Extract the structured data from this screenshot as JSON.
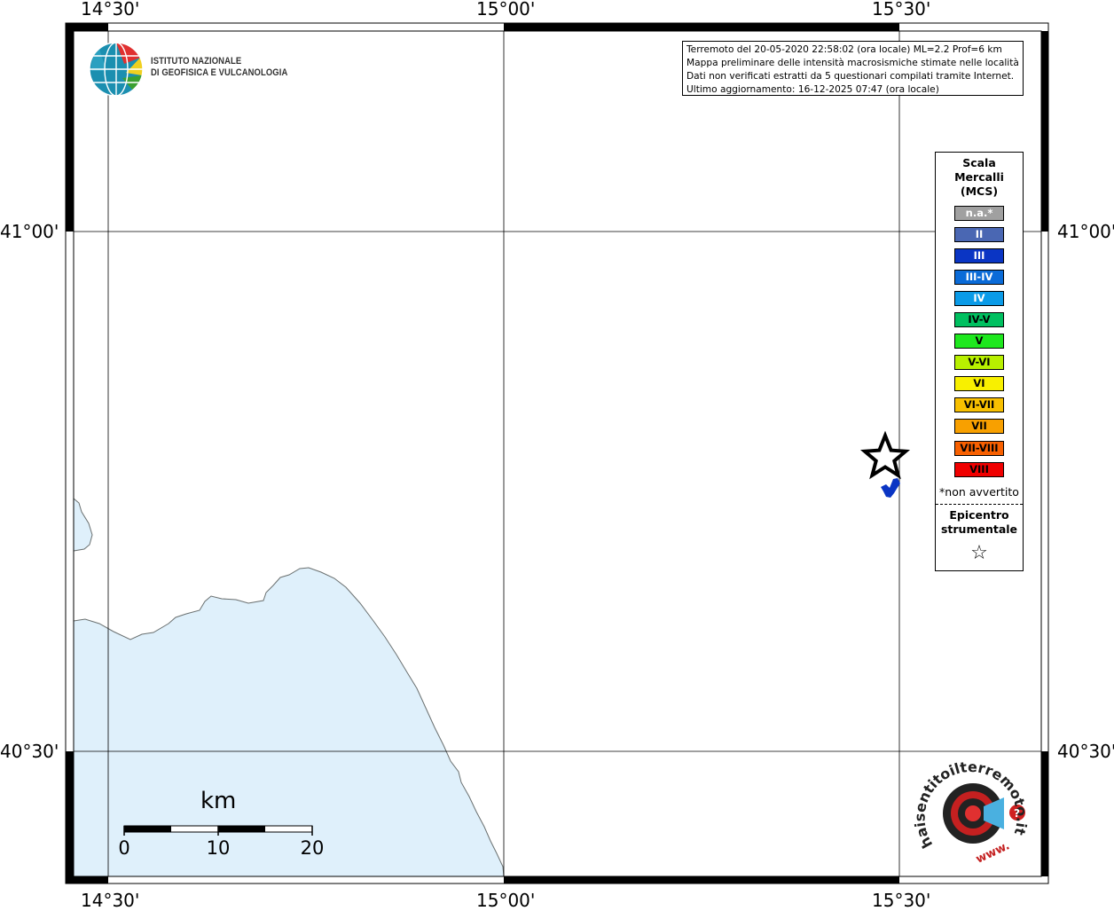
{
  "info_lines": [
    "Terremoto del 20-05-2020 22:58:02 (ora locale) ML=2.2 Prof=6 km",
    "Mappa preliminare delle intensità macrosismiche stimate nelle località",
    "Dati non verificati estratti da 5 questionari compilati tramite Internet.",
    "Ultimo aggiornamento: 16-12-2025 07:47 (ora locale)"
  ],
  "logo": {
    "line1": "ISTITUTO NAZIONALE",
    "line2": "DI GEOFISICA E VULCANOLOGIA"
  },
  "ticks": {
    "lon": [
      "14°30'",
      "15°00'",
      "15°30'"
    ],
    "lat": [
      "41°00'",
      "40°30'"
    ]
  },
  "legend": {
    "title": [
      "Scala",
      "Mercalli",
      "(MCS)"
    ],
    "items": [
      {
        "label": "n.a.*",
        "color": "#a0a0a0",
        "text_color": "#ffffff"
      },
      {
        "label": "II",
        "color": "#4a67b3",
        "text_color": "#ffffff"
      },
      {
        "label": "III",
        "color": "#0a35c4",
        "text_color": "#ffffff"
      },
      {
        "label": "III-IV",
        "color": "#0a6bd8",
        "text_color": "#ffffff"
      },
      {
        "label": "IV",
        "color": "#0a9be8",
        "text_color": "#ffffff"
      },
      {
        "label": "IV-V",
        "color": "#00c060",
        "text_color": "#000000"
      },
      {
        "label": "V",
        "color": "#1ee81e",
        "text_color": "#000000"
      },
      {
        "label": "V-VI",
        "color": "#b8f000",
        "text_color": "#000000"
      },
      {
        "label": "VI",
        "color": "#f8f000",
        "text_color": "#000000"
      },
      {
        "label": "VI-VII",
        "color": "#f8c000",
        "text_color": "#000000"
      },
      {
        "label": "VII",
        "color": "#f8a000",
        "text_color": "#000000"
      },
      {
        "label": "VII-VIII",
        "color": "#f86000",
        "text_color": "#000000"
      },
      {
        "label": "VIII",
        "color": "#f00000",
        "text_color": "#000000"
      }
    ],
    "note": "*non avvertito",
    "epicenter_label": [
      "Epicentro",
      "strumentale"
    ],
    "epicenter_symbol": "☆"
  },
  "scalebar": {
    "unit": "km",
    "labels": [
      "0",
      "10",
      "20"
    ]
  },
  "hsit": {
    "text_main": "haisentitoilterremoto.it",
    "text_www": "www.",
    "badge": "?"
  },
  "colors": {
    "sea": "#dff0fb",
    "coast": "#6a7070",
    "felt": "#0a35c4"
  }
}
